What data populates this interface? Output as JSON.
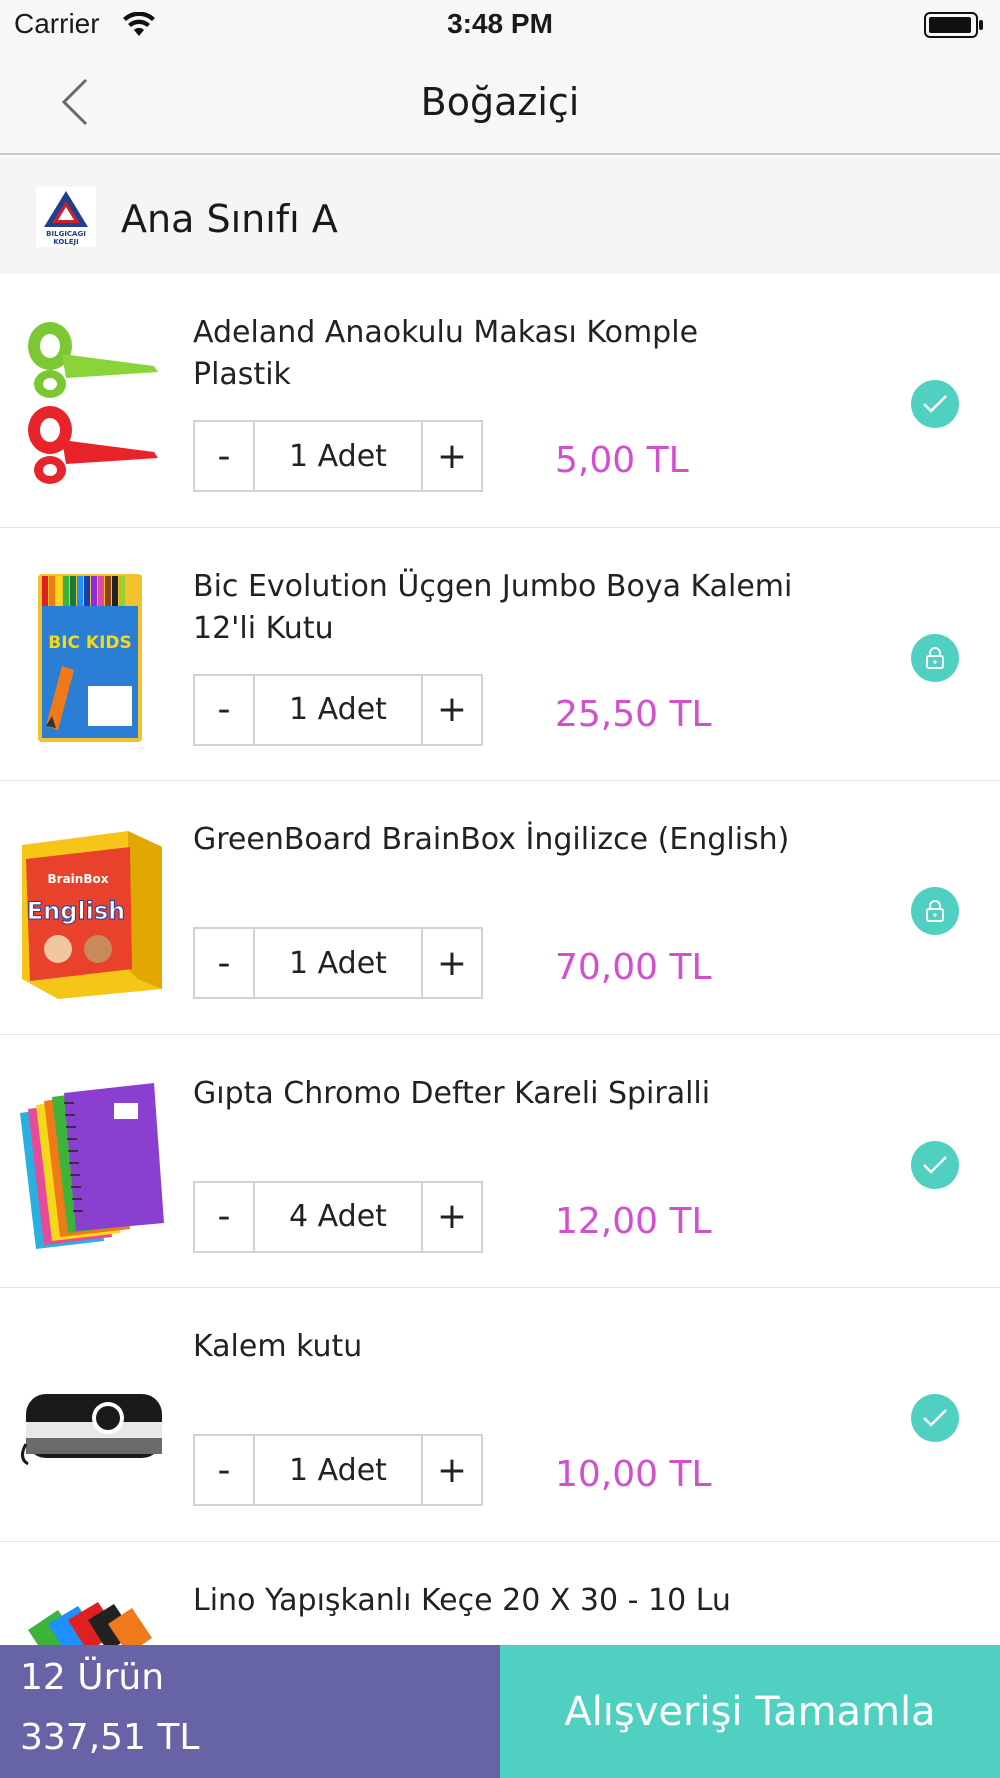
{
  "status_bar": {
    "carrier": "Carrier",
    "time": "3:48 PM"
  },
  "nav": {
    "title": "Boğaziçi"
  },
  "class_header": {
    "title": "Ana Sınıfı A",
    "logo_text_line1": "BILGICAGI",
    "logo_text_line2": "KOLEJI"
  },
  "products": [
    {
      "name": "Adeland Anaokulu Makası Komple Plastik",
      "quantity": "1 Adet",
      "price": "5,00 TL",
      "status": "check"
    },
    {
      "name": "Bic Evolution Üçgen Jumbo Boya Kalemi 12'li Kutu",
      "quantity": "1 Adet",
      "price": "25,50 TL",
      "status": "lock"
    },
    {
      "name": "GreenBoard BrainBox İngilizce (English)",
      "quantity": "1 Adet",
      "price": "70,00 TL",
      "status": "lock"
    },
    {
      "name": "Gıpta Chromo Defter Kareli Spiralli",
      "quantity": "4 Adet",
      "price": "12,00 TL",
      "status": "check"
    },
    {
      "name": "Kalem kutu",
      "quantity": "1 Adet",
      "price": "10,00 TL",
      "status": "check"
    },
    {
      "name": "Lino Yapışkanlı Keçe 20 X 30 - 10 Lu"
    }
  ],
  "qty_controls": {
    "minus": "-",
    "plus": "+"
  },
  "product_images": {
    "box_text": "English",
    "box_brand": "BrainBox",
    "crayon_brand": "BIC KIDS"
  },
  "summary": {
    "count": "12 Ürün",
    "total": "337,51 TL"
  },
  "checkout": {
    "label": "Alışverişi Tamamla"
  },
  "colors": {
    "accent": "#4fd0c0",
    "price": "#d24fd0",
    "summary_bg": "#6663a7"
  }
}
